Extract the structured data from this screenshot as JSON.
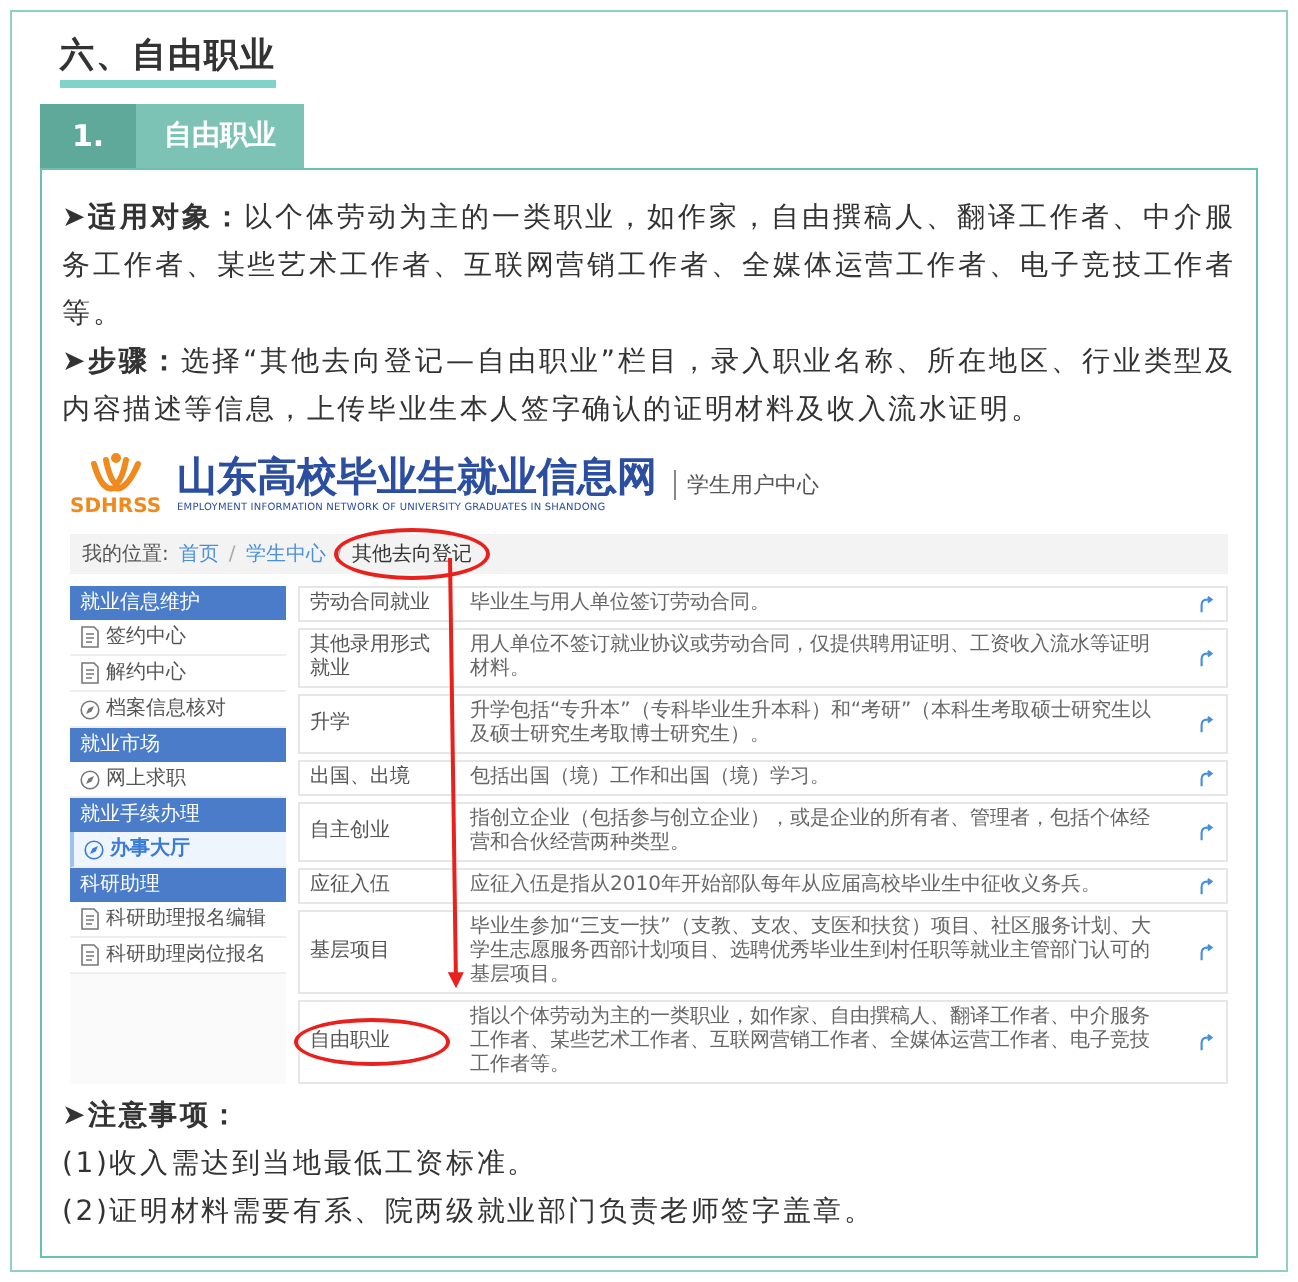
{
  "section_heading": "六、自由职业",
  "subsection": {
    "number": "1.",
    "title": "自由职业"
  },
  "paragraphs": [
    {
      "label": "➤适用对象：",
      "text": "以个体劳动为主的一类职业，如作家，自由撰稿人、翻译工作者、中介服务工作者、某些艺术工作者、互联网营销工作者、全媒体运营工作者、电子竞技工作者等。"
    },
    {
      "label": "➤步骤：",
      "text": "选择“其他去向登记—自由职业”栏目，录入职业名称、所在地区、行业类型及内容描述等信息，上传毕业生本人签字确认的证明材料及收入流水证明。"
    }
  ],
  "embedded_screenshot": {
    "logo_text": "SDHRSS",
    "site_title": "山东高校毕业生就业信息网",
    "site_subtitle": "EMPLOYMENT INFORMATION NETWORK OF UNIVERSITY GRADUATES IN SHANDONG",
    "portal": "学生用户中心",
    "breadcrumb_label": "我的位置:",
    "breadcrumb": [
      {
        "text": "首页",
        "kind": "link",
        "highlighted": false
      },
      {
        "text": "/",
        "kind": "separator",
        "highlighted": false
      },
      {
        "text": "学生中心",
        "kind": "link",
        "highlighted": false
      },
      {
        "text": "/",
        "kind": "separator",
        "highlighted": false
      },
      {
        "text": "其他去向登记",
        "kind": "current",
        "highlighted": true
      }
    ],
    "sidebar": [
      {
        "kind": "header",
        "label": "就业信息维护"
      },
      {
        "kind": "document",
        "label": "签约中心",
        "selected": false
      },
      {
        "kind": "document",
        "label": "解约中心",
        "selected": false
      },
      {
        "kind": "compass",
        "label": "档案信息核对",
        "selected": false
      },
      {
        "kind": "header",
        "label": "就业市场"
      },
      {
        "kind": "compass",
        "label": "网上求职",
        "selected": false
      },
      {
        "kind": "header",
        "label": "就业手续办理"
      },
      {
        "kind": "compass",
        "label": "办事大厅",
        "selected": true
      },
      {
        "kind": "header",
        "label": "科研助理"
      },
      {
        "kind": "document",
        "label": "科研助理报名编辑",
        "selected": false
      },
      {
        "kind": "document",
        "label": "科研助理岗位报名",
        "selected": false
      }
    ],
    "rows": [
      {
        "label": "劳动合同就业",
        "description": "毕业生与用人单位签订劳动合同。",
        "highlighted": false
      },
      {
        "label": "其他录用形式就业",
        "description": "用人单位不签订就业协议或劳动合同，仅提供聘用证明、工资收入流水等证明材料。",
        "highlighted": false
      },
      {
        "label": "升学",
        "description": "升学包括“专升本”（专科毕业生升本科）和“考研”（本科生考取硕士研究生以及硕士研究生考取博士研究生）。",
        "highlighted": false
      },
      {
        "label": "出国、出境",
        "description": "包括出国（境）工作和出国（境）学习。",
        "highlighted": false
      },
      {
        "label": "自主创业",
        "description": "指创立企业（包括参与创立企业），或是企业的所有者、管理者，包括个体经营和合伙经营两种类型。",
        "highlighted": false
      },
      {
        "label": "应征入伍",
        "description": "应征入伍是指从2010年开始部队每年从应届高校毕业生中征收义务兵。",
        "highlighted": false
      },
      {
        "label": "基层项目",
        "description": "毕业生参加“三支一扶”（支教、支农、支医和扶贫）项目、社区服务计划、大学生志愿服务西部计划项目、选聘优秀毕业生到村任职等就业主管部门认可的基层项目。",
        "highlighted": false
      },
      {
        "label": "自由职业",
        "description": "指以个体劳动为主的一类职业，如作家、自由撰稿人、翻译工作者、中介服务工作者、某些艺术工作者、互联网营销工作者、全媒体运营工作者、电子竞技工作者等。",
        "highlighted": true
      }
    ],
    "annotation_arrow": true
  },
  "notes": {
    "title": "➤注意事项：",
    "items": [
      "(1)收入需达到当地最低工资标准。",
      "(2)证明材料需要有系、院两级就业部门负责老师签字盖章。"
    ]
  }
}
